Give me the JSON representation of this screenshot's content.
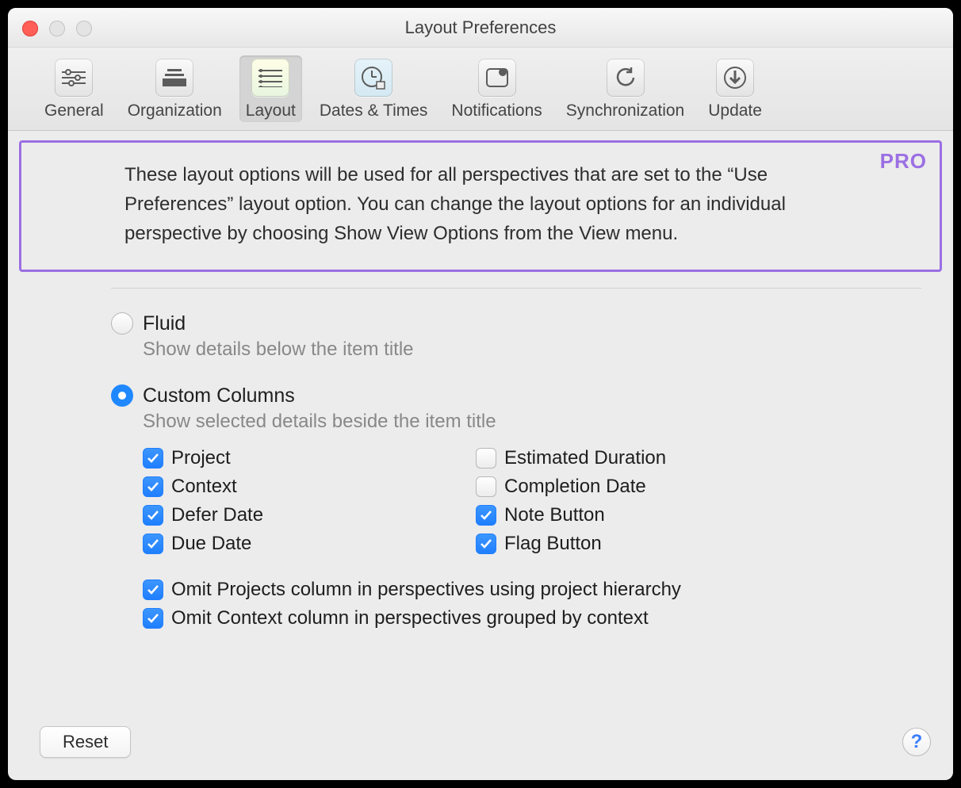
{
  "window": {
    "title": "Layout Preferences"
  },
  "toolbar": {
    "tabs": [
      {
        "label": "General",
        "selected": false
      },
      {
        "label": "Organization",
        "selected": false
      },
      {
        "label": "Layout",
        "selected": true
      },
      {
        "label": "Dates & Times",
        "selected": false
      },
      {
        "label": "Notifications",
        "selected": false
      },
      {
        "label": "Synchronization",
        "selected": false
      },
      {
        "label": "Update",
        "selected": false
      }
    ]
  },
  "callout": {
    "pro_tag": "PRO",
    "text": "These layout options will be used for all perspectives that are set to the “Use Preferences” layout option. You can change the layout options for an individual perspective by choosing Show View Options from the View menu."
  },
  "layout_modes": {
    "fluid": {
      "label": "Fluid",
      "sub": "Show details below the item title",
      "selected": false
    },
    "custom": {
      "label": "Custom Columns",
      "sub": "Show selected details beside the item title",
      "selected": true
    }
  },
  "columns_left": [
    {
      "label": "Project",
      "checked": true
    },
    {
      "label": "Context",
      "checked": true
    },
    {
      "label": "Defer Date",
      "checked": true
    },
    {
      "label": "Due Date",
      "checked": true
    }
  ],
  "columns_right": [
    {
      "label": "Estimated Duration",
      "checked": false
    },
    {
      "label": "Completion Date",
      "checked": false
    },
    {
      "label": "Note Button",
      "checked": true
    },
    {
      "label": "Flag Button",
      "checked": true
    }
  ],
  "omit_options": [
    {
      "label": "Omit Projects column in perspectives using project hierarchy",
      "checked": true
    },
    {
      "label": "Omit Context column in perspectives grouped by context",
      "checked": true
    }
  ],
  "footer": {
    "reset_label": "Reset",
    "help_label": "?"
  }
}
